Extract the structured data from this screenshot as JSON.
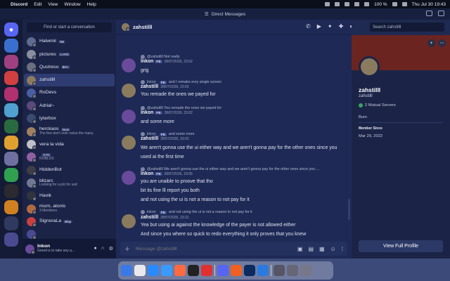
{
  "menubar": {
    "app": "Discord",
    "items": [
      "Edit",
      "View",
      "Window",
      "Help"
    ],
    "battery": "100 %",
    "clock": "Thu Jul 30  19:43"
  },
  "window": {
    "title": "Direct Messages"
  },
  "dm_list": {
    "find_placeholder": "Find or start a conversation",
    "items": [
      {
        "name": "Halwmii",
        "tag": "NB",
        "sub": "",
        "color": "#5f6b8f"
      },
      {
        "name": "pictures",
        "tag": "CARD",
        "sub": "",
        "color": "#8a8f9e"
      },
      {
        "name": "Qustreso",
        "tag": "$DC",
        "sub": "",
        "color": "#6a7080"
      },
      {
        "name": "zahstilll",
        "tag": "",
        "sub": "",
        "color": "#8b7b5e"
      },
      {
        "name": "RoDevs",
        "tag": "",
        "sub": "",
        "color": "#4a5fa0"
      },
      {
        "name": "Adrial~",
        "tag": "",
        "sub": "",
        "color": "#5b4a7a"
      },
      {
        "name": "lytarbox",
        "tag": "",
        "sub": "",
        "color": "#3a4a70"
      },
      {
        "name": "herckaos",
        "tag": "kaos",
        "sub": "The few don't over-value the many.",
        "color": "#a08060"
      },
      {
        "name": "vera la vida",
        "tag": "",
        "sub": "",
        "color": "#c0c0c8"
      },
      {
        "name": "",
        "tag": "GTD",
        "sub": "ROBLOX",
        "color": "#9060a0"
      },
      {
        "name": "HiddenBot",
        "tag": "",
        "sub": "",
        "color": "#3e3e44"
      },
      {
        "name": "blizarc",
        "tag": "",
        "sub": "Looking for a job for usd",
        "color": "#707890"
      },
      {
        "name": "Havik",
        "tag": "",
        "sub": "",
        "color": "#30343c"
      },
      {
        "name": "murn, atonis",
        "tag": "",
        "sub": "3 Members",
        "color": "#b06a40"
      },
      {
        "name": "SignoraLa",
        "tag": "Blap",
        "sub": "",
        "color": "#c84040"
      },
      {
        "name": "",
        "tag": "",
        "sub": "",
        "color": "#4a4a90"
      }
    ]
  },
  "user_panel": {
    "name": "lnkon",
    "status": "Greed is to take any a..."
  },
  "chat": {
    "header_name": "zahstilll",
    "search_placeholder": "Search zahstilll",
    "composer_placeholder": "Message @zahstilll",
    "messages": [
      {
        "kind": "text",
        "text": "Not really"
      },
      {
        "kind": "reply",
        "text": "@zahstilll Not really"
      },
      {
        "kind": "author",
        "author": "lnkon",
        "tag": "PB",
        "time": "28/07/2026, 23:02"
      },
      {
        "kind": "text",
        "text": "grig"
      },
      {
        "kind": "reply",
        "who": "lnkon",
        "tag": "PB",
        "text": "and I remake evry single screen"
      },
      {
        "kind": "author",
        "author": "zahstilll",
        "tag": "",
        "time": "28/07/2026, 23:02"
      },
      {
        "kind": "text",
        "text": "You remade the ones we payed for"
      },
      {
        "kind": "reply",
        "text": "@zahstilll You remade the ones we payed for"
      },
      {
        "kind": "author",
        "author": "lnkon",
        "tag": "PB",
        "time": "28/07/2026, 23:02"
      },
      {
        "kind": "text",
        "text": "and some more"
      },
      {
        "kind": "reply",
        "who": "lnkon",
        "tag": "PB",
        "text": "and some more"
      },
      {
        "kind": "author",
        "author": "zahstilll",
        "tag": "",
        "time": "28/07/2026, 23:02"
      },
      {
        "kind": "text",
        "text": "We aren't gonna use the ui either way and we aren't gonna pay for the other ones since you"
      },
      {
        "kind": "text",
        "text": "used ai the first time"
      },
      {
        "kind": "reply",
        "text": "@zahstilll We aren't gonna use the ui either way and we aren't gonna pay for the other ones since you ..."
      },
      {
        "kind": "author",
        "author": "lnkon",
        "tag": "PB",
        "time": "28/07/2026, 23:05"
      },
      {
        "kind": "text",
        "text": "you are unaible to proove that tho"
      },
      {
        "kind": "text",
        "text": "bit its fine lll report you both"
      },
      {
        "kind": "text",
        "text": "and not using the ui is not a reason to not pay for it"
      },
      {
        "kind": "reply",
        "who": "lnkon",
        "tag": "PB",
        "text": "and not using the ui is not a reason to not pay for it"
      },
      {
        "kind": "author",
        "author": "zahstilll",
        "tag": "",
        "time": "28/07/2026, 23:31"
      },
      {
        "kind": "text",
        "text": "Yea but using ai against the knowledge of the payer is not allowed either"
      },
      {
        "kind": "text",
        "text": "And since you where so quick to redo everything it only proves that you knew"
      }
    ]
  },
  "profile": {
    "display_name": "zahstilll",
    "username": "zahstilll",
    "mutual": "2 Mutual Servers",
    "bio": "Bum",
    "member_since_label": "Member Since",
    "member_since": "Mar 29, 2022",
    "view_full": "View Full Profile"
  },
  "colors": {
    "accent": "#5865f2",
    "banner": "#6b2420"
  }
}
